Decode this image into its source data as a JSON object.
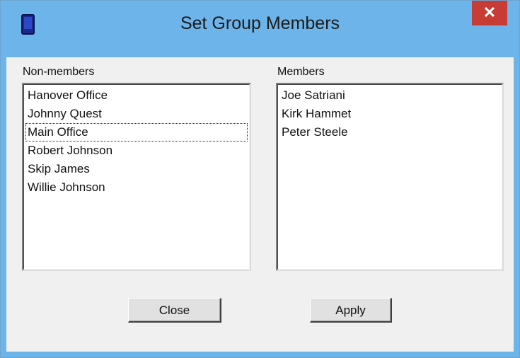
{
  "window": {
    "title": "Set Group Members",
    "close_label": "✕",
    "icon": "phone-icon"
  },
  "nonmembers": {
    "label": "Non-members",
    "items": [
      "Hanover Office",
      "Johnny Quest",
      "Main Office",
      "Robert Johnson",
      "Skip James",
      "Willie Johnson"
    ],
    "focused_item": "Main Office"
  },
  "members": {
    "label": "Members",
    "items": [
      "Joe Satriani",
      "Kirk Hammet",
      "Peter Steele"
    ]
  },
  "buttons": {
    "close_label": "Close",
    "apply_label": "Apply"
  },
  "colors": {
    "titlebar": "#6cb4e9",
    "close_button": "#c73c34",
    "dialog_bg": "#f0f0f0"
  }
}
